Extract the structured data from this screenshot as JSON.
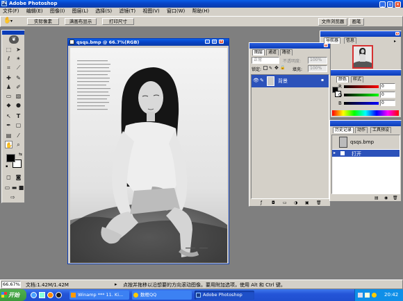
{
  "app": {
    "title": "Adobe Photoshop",
    "icon": "photoshop-icon"
  },
  "menu": [
    "文件(F)",
    "编辑(E)",
    "图像(I)",
    "图层(L)",
    "选择(S)",
    "滤镜(T)",
    "视图(V)",
    "窗口(W)",
    "帮助(H)"
  ],
  "options": {
    "btn_actual": "实际像素",
    "btn_fit": "满画布显示",
    "btn_print": "打印尺寸",
    "well_tabs": [
      "文件浏览器",
      "画笔"
    ]
  },
  "document": {
    "title": "qsqs.bmp @ 66.7%(RGB)"
  },
  "layers": {
    "tabs": [
      "图层",
      "通道",
      "路径"
    ],
    "blend": "正常",
    "opacity_label": "不透明度:",
    "opacity": "100%",
    "lock_label": "锁定:",
    "fill_label": "填充:",
    "fill": "100%",
    "layer_name": "背景"
  },
  "navigator": {
    "tabs": [
      "导航器",
      "信息"
    ]
  },
  "color": {
    "tabs": [
      "颜色",
      "样式"
    ],
    "r_label": "R",
    "g_label": "G",
    "b_label": "B",
    "r": "0",
    "g": "0",
    "b": "0"
  },
  "history": {
    "tabs": [
      "历史记录",
      "动作",
      "工具预设"
    ],
    "snapshot": "qsqs.bmp",
    "step": "打开"
  },
  "status": {
    "zoom": "66.67%",
    "doc": "文档:1.42M/1.42M",
    "hint": "点按并拖移以沿想要的方向滚动图像。要用附加选项，使用 Alt 和 Ctrl 键。"
  },
  "taskbar": {
    "start": "开始",
    "tasks": [
      "Winamp *** 11. Ki...",
      "数框QQ",
      "Adobe Photoshop"
    ],
    "time": "20:42"
  },
  "colors": {
    "xp_blue": "#0a46d8",
    "panel": "#d4d0c8",
    "workspace": "#7f7f7f",
    "highlight": "#2c52ba",
    "taskbar": "#2455d8",
    "start": "#3c9a3c"
  }
}
